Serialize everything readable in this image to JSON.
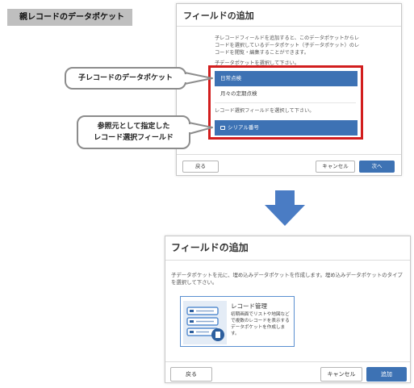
{
  "tag": {
    "label": "親レコードのデータポケット"
  },
  "dialog1": {
    "title": "フィールドの追加",
    "description": "子レコードフィールドを追加すると、このデータポケットからレコードを選択しているデータポケット（子データポケット）のレコードを閲覧・編集することができます。",
    "select_pocket_prompt": "子データポケットを選択して下さい。",
    "pocket_options": [
      "日常点検",
      "月々の定期点検"
    ],
    "select_field_prompt": "レコード選択フィールドを選択して下さい。",
    "field_option": "シリアル番号",
    "back_label": "戻る",
    "cancel_label": "キャンセル",
    "next_label": "次へ"
  },
  "callouts": {
    "child_pocket": "子レコードのデータポケット",
    "ref_field_line1": "参照元として指定した",
    "ref_field_line2": "レコード選択フィールド"
  },
  "dialog2": {
    "title": "フィールドの追加",
    "description": "子データポケットを元に、埋め込みデータポケットを作成します。埋め込みデータポケットのタイプを選択して下さい。",
    "card": {
      "title": "レコード管理",
      "description": "初期画面でリストや地図などで複数のレコードを表示するデータポケットを作成します。"
    },
    "back_label": "戻る",
    "cancel_label": "キャンセル",
    "add_label": "追加"
  },
  "colors": {
    "accent": "#3d72b4",
    "highlight": "#d21e1e",
    "arrow": "#4a7cc4"
  }
}
